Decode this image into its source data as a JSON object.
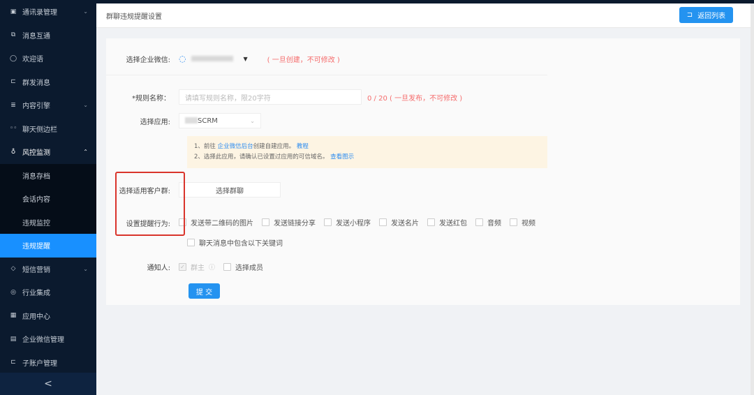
{
  "sidebar": {
    "items": [
      {
        "label": "通讯录管理",
        "icon": "contacts-icon",
        "chevron": true
      },
      {
        "label": "消息互通",
        "icon": "message-icon"
      },
      {
        "label": "欢迎语",
        "icon": "chat-icon"
      },
      {
        "label": "群发消息",
        "icon": "broadcast-icon"
      },
      {
        "label": "内容引擎",
        "icon": "content-icon",
        "chevron": true
      },
      {
        "label": "聊天侧边栏",
        "icon": "sidebar-icon"
      },
      {
        "label": "风控监测",
        "icon": "mic-icon",
        "expanded": true
      }
    ],
    "sub_items": [
      "消息存档",
      "会话内容",
      "违规监控",
      "违规提醒"
    ],
    "items_after": [
      {
        "label": "短信营销",
        "icon": "sms-icon",
        "chevron": true
      },
      {
        "label": "行业集成",
        "icon": "eye-icon"
      },
      {
        "label": "应用中心",
        "icon": "apps-icon"
      },
      {
        "label": "企业微信管理",
        "icon": "wecom-icon"
      },
      {
        "label": "子账户管理",
        "icon": "account-icon"
      }
    ],
    "collapse": "<"
  },
  "header": {
    "title": "群聊违规提醒设置",
    "back_button": "返回列表"
  },
  "form": {
    "corp_label": "选择企业微信:",
    "corp_note": "( 一旦创建，不可修改 )",
    "rule_label": "*规则名称：",
    "rule_placeholder": "请填写规则名称，限20字符",
    "rule_counter": "0 / 20 ( 一旦发布，不可修改 )",
    "app_label": "选择应用:",
    "app_value": "SCRM",
    "tip1_prefix": "1、前往 ",
    "tip1_link": "企业微信后台",
    "tip1_mid": "创建自建应用。 ",
    "tip1_link2": "教程",
    "tip2_prefix": "2、选择此应用，请确认已设置过应用的可信域名。 ",
    "tip2_link": "查看图示",
    "group_label": "选择适用客户群:",
    "group_button": "选择群聊",
    "behavior_label": "设置提醒行为:",
    "behaviors": [
      "发送带二维码的图片",
      "发送链接分享",
      "发送小程序",
      "发送名片",
      "发送红包",
      "音频",
      "视频"
    ],
    "keyword_option": "聊天消息中包含以下关键词",
    "notify_label": "通知人:",
    "notify_owner": "群主",
    "notify_member": "选择成员",
    "submit": "提 交"
  }
}
